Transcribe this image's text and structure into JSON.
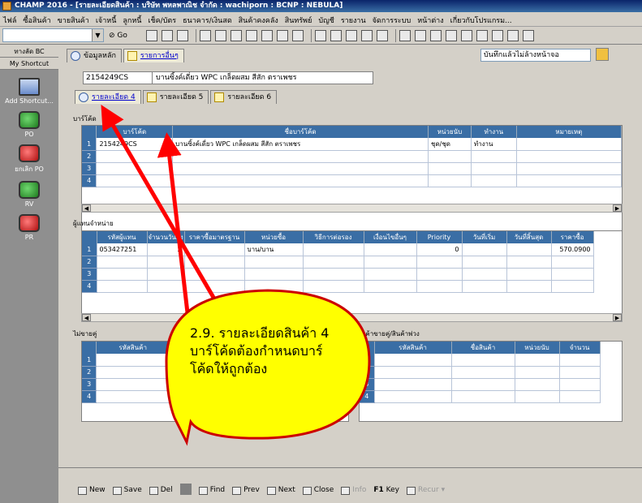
{
  "window": {
    "title": "CHAMP 2016 - [รายละเอียดสินค้า : บริษัท พหลพาณิช จำกัด : wachiporn : BCNP : NEBULA]"
  },
  "menu": [
    "ไฟล์",
    "ซื้อสินค้า",
    "ขายสินค้า",
    "เจ้าหนี้",
    "ลูกหนี้",
    "เช็ค/บัตร",
    "ธนาคาร/เงินสด",
    "สินค้าคงคลัง",
    "สินทรัพย์",
    "บัญชี",
    "รายงาน",
    "จัดการระบบ",
    "หน้าต่าง",
    "เกี่ยวกับโปรแกรม..."
  ],
  "toolbar": {
    "go_label": "Go"
  },
  "sidebar": {
    "tab_top": "ทางลัด BC",
    "tab_second": "My Shortcut",
    "items": [
      {
        "label": "Add Shortcut...",
        "icon": "add-shortcut-icon"
      },
      {
        "label": "PO",
        "icon": "po-icon"
      },
      {
        "label": "ยกเลิก PO",
        "icon": "cancel-po-icon"
      },
      {
        "label": "RV",
        "icon": "rv-icon"
      },
      {
        "label": "PR",
        "icon": "pr-icon"
      }
    ]
  },
  "tabs": [
    "ข้อมูลหลัก",
    "รายการอื่นๆ"
  ],
  "saved_mode": "บันทึกแล้วไม่ล้างหน้าจอ",
  "product": {
    "code": "2154249CS",
    "name": "บานซิ้งค์เดี่ยว WPC เกล็ดผสม สีสัก ตราเพชร"
  },
  "subtabs": [
    "รายละเอียด 4",
    "รายละเอียด 5",
    "รายละเอียด 6"
  ],
  "barcode_section": {
    "label": "บาร์โค้ด",
    "columns": [
      "บาร์โค้ด",
      "ชื่อบาร์โค้ด",
      "หน่วยนับ",
      "ทำงาน",
      "หมายเหตุ"
    ],
    "rows": [
      [
        "1",
        "2154249CS",
        "บานซิ้งค์เดี่ยว WPC เกล็ดผสม สีสัก ตราเพชร",
        "ชุด/ชุด",
        "ทำงาน",
        ""
      ],
      [
        "2",
        "",
        "",
        "",
        "",
        ""
      ],
      [
        "3",
        "",
        "",
        "",
        "",
        ""
      ],
      [
        "4",
        "",
        "",
        "",
        "",
        ""
      ]
    ]
  },
  "agent_section": {
    "label": "ผู้แทนจำหน่าย",
    "columns": [
      "รหัสผู้แทน",
      "จำนวนวันส่ง",
      "ราคาซื้อมาตรฐาน",
      "หน่วยซื้อ",
      "วิธีการต่อรอง",
      "เงื่อนไขอื่นๆ",
      "Priority",
      "วันที่เริ่ม",
      "วันที่สิ้นสุด",
      "ราคาซื้อ"
    ],
    "rows": [
      [
        "1",
        "053427251",
        "3",
        "",
        "บาน/บาน",
        "",
        "",
        "0",
        "",
        "",
        "570.0900"
      ],
      [
        "2",
        "",
        "",
        "",
        "",
        "",
        "",
        "",
        "",
        "",
        ""
      ],
      [
        "3",
        "",
        "",
        "",
        "",
        "",
        "",
        "",
        "",
        "",
        ""
      ],
      [
        "4",
        "",
        "",
        "",
        "",
        "",
        "",
        "",
        "",
        "",
        ""
      ]
    ]
  },
  "pair_left": {
    "label": "ไม่ขายคู่",
    "columns": [
      "รหัสสินค้า"
    ],
    "rows": [
      "1",
      "2",
      "3",
      "4"
    ]
  },
  "pair_right": {
    "label": "สินค้าขายคู่/สินค้าพ่วง",
    "columns": [
      "รหัสสินค้า",
      "ชื่อสินค้า",
      "หน่วยนับ",
      "จำนวน"
    ],
    "rows": [
      "1",
      "2",
      "3",
      "4"
    ]
  },
  "bottom": {
    "new": "New",
    "save": "Save",
    "del": "Del",
    "find": "Find",
    "prev": "Prev",
    "next": "Next",
    "close": "Close",
    "info": "Info",
    "key": "Key",
    "key_prefix": "F1",
    "recur": "Recur"
  },
  "callout": {
    "text": "2.9. รายละเอียดสินค้า 4 บาร์โค้ดต้องกำหนดบาร์โค้ดให้ถูกต้อง",
    "fill": "#ffff00",
    "stroke": "#cc0000",
    "arrow": "#ff0000"
  }
}
